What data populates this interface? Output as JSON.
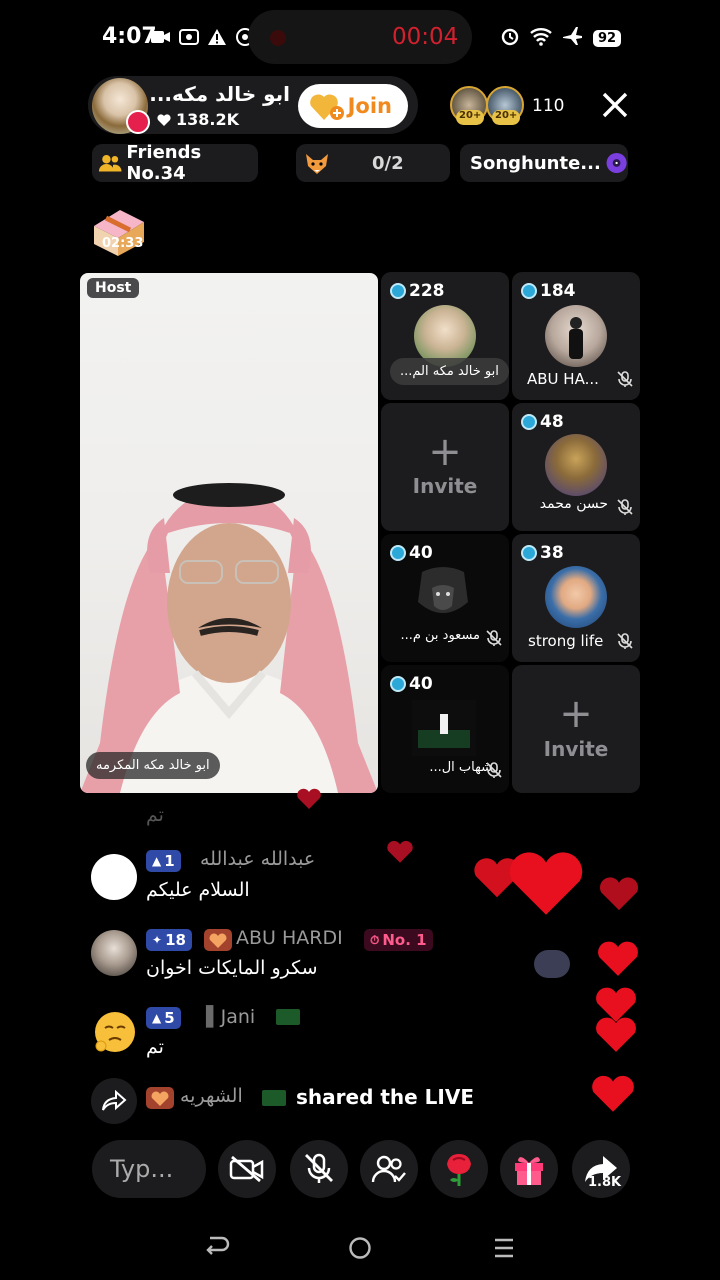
{
  "status_bar": {
    "time": "4:07",
    "recording": "00:04",
    "battery": "92"
  },
  "host_card": {
    "name": "ابو خالد مكه...",
    "likes": "138.2K",
    "join_label": "Join"
  },
  "viewers": {
    "badge1": "20+",
    "badge2": "20+",
    "count": "110"
  },
  "chips": {
    "friends": "Friends No.34",
    "progress": "0/2",
    "song": "Songhunte..."
  },
  "chest_timer": "02:33",
  "host_tile": {
    "badge": "Host",
    "caption": "ابو خالد مكه المكرمه"
  },
  "seats": [
    {
      "count": "228",
      "name": "ابو خالد مكه الم..."
    },
    {
      "count": "184",
      "name": "ABU HA..."
    },
    {
      "count": "48",
      "name": "حسن محمد"
    },
    {
      "count": "40",
      "name": "مسعود بن م..."
    },
    {
      "count": "38",
      "name": "strong life"
    },
    {
      "count": "40",
      "name": "شهاب ال..."
    }
  ],
  "invite_label": "Invite",
  "chat": {
    "faded_msg": "تم",
    "messages": [
      {
        "level": "1",
        "name": "عبدالله عبدالله",
        "text": "السلام عليكم"
      },
      {
        "level": "18",
        "name": "ABU HARDI",
        "rank": "No. 1",
        "text": "سكرو المايكات اخوان"
      },
      {
        "level": "5",
        "name": "Jani",
        "text": "تم"
      }
    ],
    "share": {
      "name": "الشهريه",
      "text": "shared the LIVE"
    }
  },
  "bottom_bar": {
    "type_placeholder": "Typ...",
    "share_count": "1.8K"
  },
  "colors": {
    "accent_red": "#e6204d",
    "join_orange": "#f08a1e",
    "level_blue": "#2f4aa7"
  }
}
